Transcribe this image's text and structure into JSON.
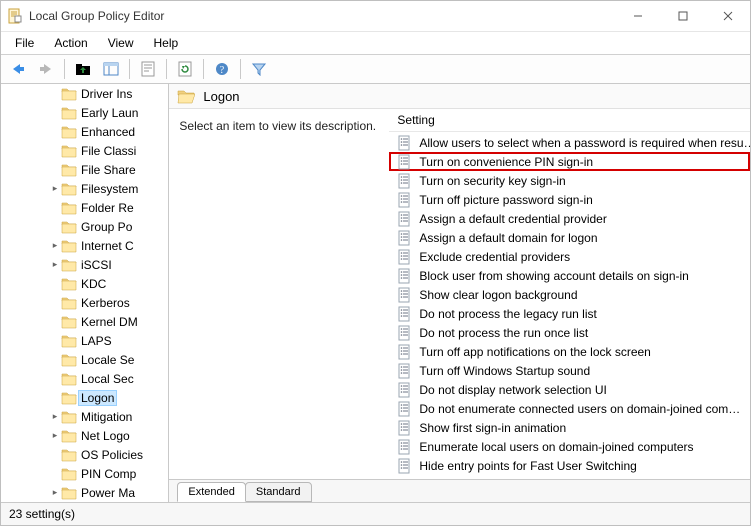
{
  "titlebar": {
    "title": "Local Group Policy Editor"
  },
  "menubar": {
    "items": [
      "File",
      "Action",
      "View",
      "Help"
    ]
  },
  "tree": {
    "items": [
      {
        "label": "Driver Ins",
        "depth": 3,
        "expander": ""
      },
      {
        "label": "Early Laun",
        "depth": 3,
        "expander": ""
      },
      {
        "label": "Enhanced",
        "depth": 3,
        "expander": ""
      },
      {
        "label": "File Classi",
        "depth": 3,
        "expander": ""
      },
      {
        "label": "File Share",
        "depth": 3,
        "expander": ""
      },
      {
        "label": "Filesystem",
        "depth": 3,
        "expander": ">"
      },
      {
        "label": "Folder Re",
        "depth": 3,
        "expander": ""
      },
      {
        "label": "Group Po",
        "depth": 3,
        "expander": ""
      },
      {
        "label": "Internet C",
        "depth": 3,
        "expander": ">"
      },
      {
        "label": "iSCSI",
        "depth": 3,
        "expander": ">"
      },
      {
        "label": "KDC",
        "depth": 3,
        "expander": ""
      },
      {
        "label": "Kerberos",
        "depth": 3,
        "expander": ""
      },
      {
        "label": "Kernel DM",
        "depth": 3,
        "expander": ""
      },
      {
        "label": "LAPS",
        "depth": 3,
        "expander": ""
      },
      {
        "label": "Locale Se",
        "depth": 3,
        "expander": ""
      },
      {
        "label": "Local Sec",
        "depth": 3,
        "expander": ""
      },
      {
        "label": "Logon",
        "depth": 3,
        "expander": "",
        "selected": true
      },
      {
        "label": "Mitigation",
        "depth": 3,
        "expander": ">"
      },
      {
        "label": "Net Logo",
        "depth": 3,
        "expander": ">"
      },
      {
        "label": "OS Policies",
        "depth": 3,
        "expander": ""
      },
      {
        "label": "PIN Comp",
        "depth": 3,
        "expander": ""
      },
      {
        "label": "Power Ma",
        "depth": 3,
        "expander": ">"
      }
    ]
  },
  "content": {
    "path_title": "Logon",
    "details_prompt": "Select an item to view its description.",
    "settings_header": "Setting",
    "settings": [
      {
        "label": "Allow users to select when a password is required when resu…"
      },
      {
        "label": "Turn on convenience PIN sign-in",
        "highlighted": true
      },
      {
        "label": "Turn on security key sign-in"
      },
      {
        "label": "Turn off picture password sign-in"
      },
      {
        "label": "Assign a default credential provider"
      },
      {
        "label": "Assign a default domain for logon"
      },
      {
        "label": "Exclude credential providers"
      },
      {
        "label": "Block user from showing account details on sign-in"
      },
      {
        "label": "Show clear logon background"
      },
      {
        "label": "Do not process the legacy run list"
      },
      {
        "label": "Do not process the run once list"
      },
      {
        "label": "Turn off app notifications on the lock screen"
      },
      {
        "label": "Turn off Windows Startup sound"
      },
      {
        "label": "Do not display network selection UI"
      },
      {
        "label": "Do not enumerate connected users on domain-joined com…"
      },
      {
        "label": "Show first sign-in animation"
      },
      {
        "label": "Enumerate local users on domain-joined computers"
      },
      {
        "label": "Hide entry points for Fast User Switching"
      }
    ],
    "tabs": [
      {
        "label": "Extended",
        "active": true
      },
      {
        "label": "Standard",
        "active": false
      }
    ]
  },
  "statusbar": {
    "text": "23 setting(s)"
  }
}
